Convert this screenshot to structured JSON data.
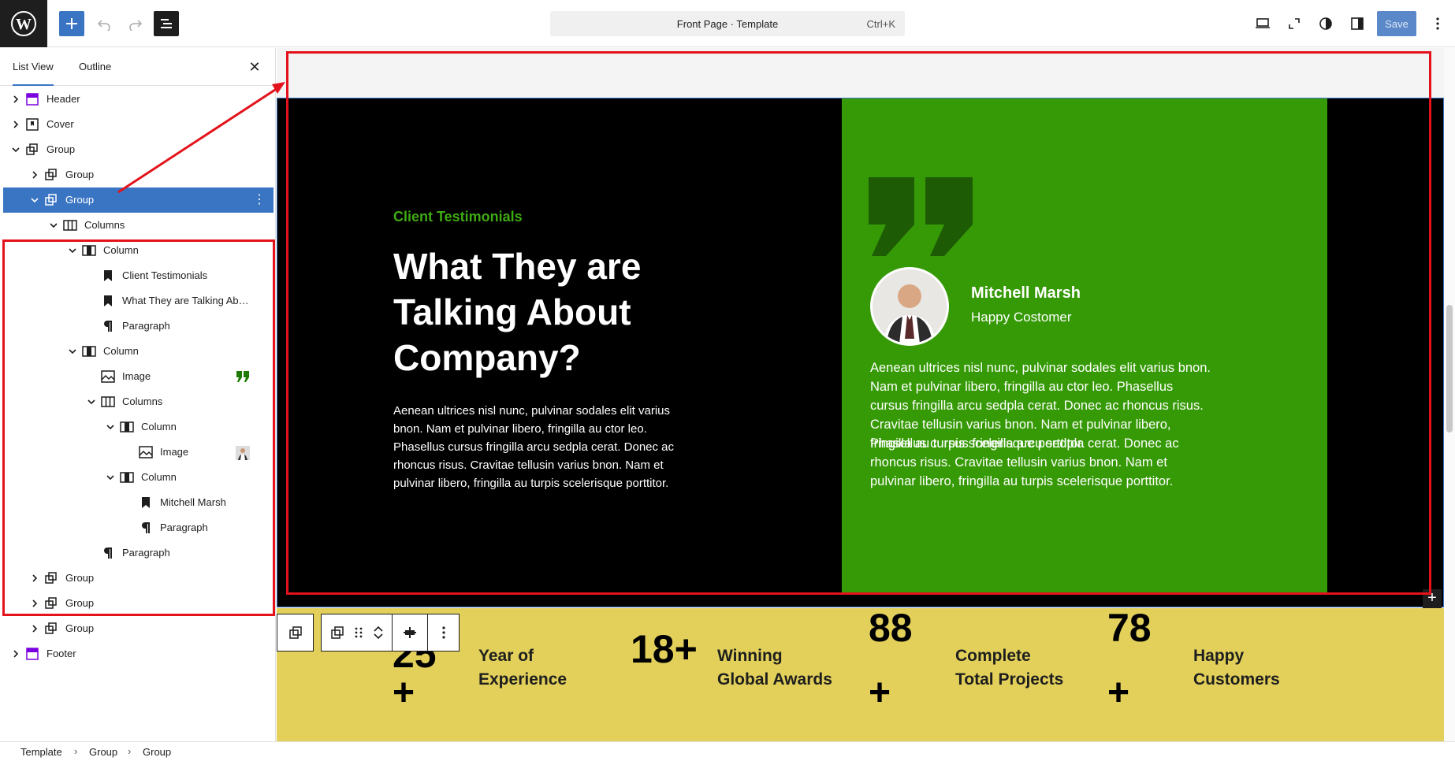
{
  "topbar": {
    "document_title": "Front Page · Template",
    "shortcut": "Ctrl+K",
    "save_label": "Save"
  },
  "sidebar": {
    "tabs": [
      "List View",
      "Outline"
    ],
    "active_tab": "List View",
    "tree": [
      {
        "label": "Header",
        "icon": "template-part-icon",
        "level": 0,
        "expanded": false
      },
      {
        "label": "Cover",
        "icon": "cover-icon",
        "level": 0,
        "expanded": false
      },
      {
        "label": "Group",
        "icon": "group-icon",
        "level": 0,
        "expanded": true
      },
      {
        "label": "Group",
        "icon": "group-icon",
        "level": 1,
        "expanded": false
      },
      {
        "label": "Group",
        "icon": "group-icon",
        "level": 1,
        "expanded": true,
        "selected": true
      },
      {
        "label": "Columns",
        "icon": "columns-icon",
        "level": 2,
        "expanded": true
      },
      {
        "label": "Column",
        "icon": "column-icon",
        "level": 3,
        "expanded": true
      },
      {
        "label": "Client Testimonials",
        "icon": "heading-icon",
        "level": 4
      },
      {
        "label": "What They are Talking Ab…",
        "icon": "heading-icon",
        "level": 4
      },
      {
        "label": "Paragraph",
        "icon": "paragraph-icon",
        "level": 4
      },
      {
        "label": "Column",
        "icon": "column-icon",
        "level": 3,
        "expanded": true
      },
      {
        "label": "Image",
        "icon": "image-icon",
        "level": 4,
        "thumb": "quote-thumb"
      },
      {
        "label": "Columns",
        "icon": "columns-icon",
        "level": 4,
        "expanded": true
      },
      {
        "label": "Column",
        "icon": "column-icon",
        "level": 5,
        "expanded": true
      },
      {
        "label": "Image",
        "icon": "image-icon",
        "level": 6,
        "thumb": "person-thumb"
      },
      {
        "label": "Column",
        "icon": "column-icon",
        "level": 5,
        "expanded": true
      },
      {
        "label": "Mitchell Marsh",
        "icon": "heading-icon",
        "level": 6
      },
      {
        "label": "Paragraph",
        "icon": "paragraph-icon",
        "level": 6
      },
      {
        "label": "Paragraph",
        "icon": "paragraph-icon",
        "level": 4
      },
      {
        "label": "Group",
        "icon": "group-icon",
        "level": 1,
        "expanded": false
      },
      {
        "label": "Group",
        "icon": "group-icon",
        "level": 1,
        "expanded": false
      },
      {
        "label": "Group",
        "icon": "group-icon",
        "level": 1,
        "expanded": false
      },
      {
        "label": "Footer",
        "icon": "template-part-icon",
        "level": 0,
        "expanded": false
      }
    ]
  },
  "canvas": {
    "testimonials": {
      "eyebrow": "Client Testimonials",
      "heading": "What They are Talking About Company?",
      "paragraph": "Aenean ultrices nisl nunc, pulvinar sodales elit varius bnon. Nam et pulvinar libero, fringilla au ctor leo. Phasellus cursus fringilla arcu sedpla cerat. Donec ac rhoncus risus. Cravitae tellusin varius bnon. Nam et pulvinar libero, fringilla au turpis scelerisque porttitor.",
      "person_name": "Mitchell Marsh",
      "person_role": "Happy Costomer",
      "card_paragraph_1": "Aenean ultrices nisl nunc, pulvinar sodales elit varius bnon. Nam et pulvinar libero, fringilla au ctor leo. Phasellus cursus fringilla arcu sedpla cerat. Donec ac rhoncus risus. Cravitae tellusin varius bnon. Nam et pulvinar libero, fringilla au turpis scelerisque porttitor.",
      "card_paragraph_2": "Phasellus cursus fringilla arcu sedpla cerat. Donec ac rhoncus risus. Cravitae tellusin varius bnon. Nam et pulvinar libero, fringilla au turpis scelerisque porttitor."
    },
    "stats": [
      {
        "number": "25",
        "suffix": "+",
        "label_1": "Year of",
        "label_2": "Experience"
      },
      {
        "number": "18+",
        "suffix": "",
        "label_1": "Winning",
        "label_2": "Global Awards"
      },
      {
        "number": "88",
        "suffix": "+",
        "label_1": "Complete",
        "label_2": "Total Projects"
      },
      {
        "number": "78",
        "suffix": "+",
        "label_1": "Happy",
        "label_2": "Customers"
      }
    ]
  },
  "breadcrumb": [
    "Template",
    "Group",
    "Group"
  ],
  "colors": {
    "accent": "#3a75c4",
    "highlight": "#e3121b",
    "card_green": "#369a06",
    "stats_yellow": "#e2d05a"
  }
}
